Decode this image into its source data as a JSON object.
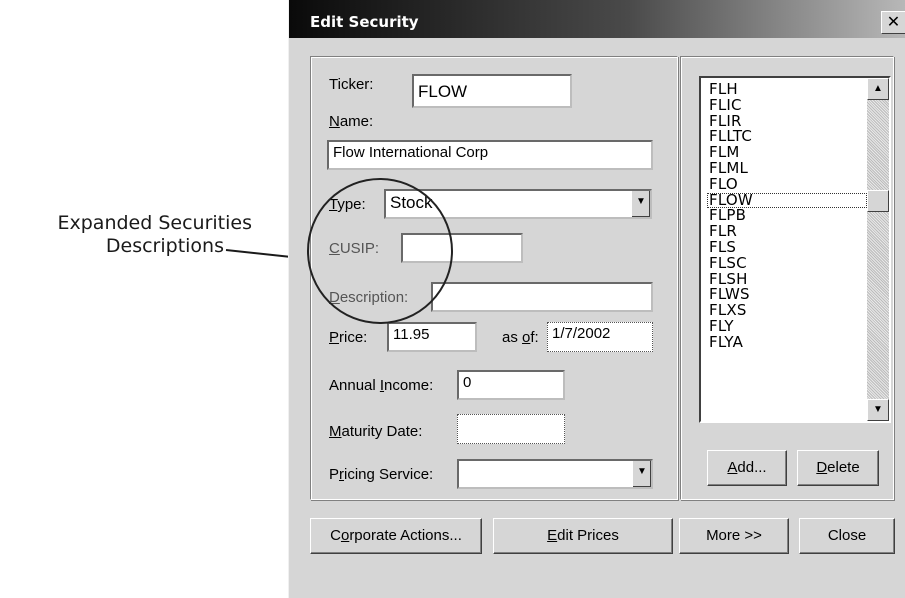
{
  "callout": {
    "line1": "Expanded Securities",
    "line2": "Descriptions"
  },
  "dialog": {
    "title": "Edit Security",
    "close_glyph": "✕",
    "ticker": {
      "label": "Ticker:",
      "value": "FLOW"
    },
    "name": {
      "label_pre": "",
      "label_u": "N",
      "label_post": "ame:",
      "value": "Flow International Corp"
    },
    "type": {
      "label_u": "T",
      "label_post": "ype:",
      "value": "Stock"
    },
    "cusip": {
      "label_u": "C",
      "label_post": "USIP:",
      "value": ""
    },
    "description": {
      "label_u": "D",
      "label_post": "escription:",
      "value": ""
    },
    "price": {
      "label_u": "P",
      "label_post": "rice:",
      "value": "11.95",
      "asof_pre": "as ",
      "asof_u": "o",
      "asof_post": "f:",
      "asof_value": "1/7/2002"
    },
    "annual_income": {
      "label_pre": "Annual ",
      "label_u": "I",
      "label_post": "ncome:",
      "value": "0"
    },
    "maturity_date": {
      "label_u": "M",
      "label_post": "aturity Date:",
      "value": ""
    },
    "pricing_service": {
      "label_pre": "P",
      "label_u": "r",
      "label_post": "icing Service:",
      "value": ""
    },
    "securities_list": [
      "FLH",
      "FLIC",
      "FLIR",
      "FLLTC",
      "FLM",
      "FLML",
      "FLO",
      "FLOW",
      "FLPB",
      "FLR",
      "FLS",
      "FLSC",
      "FLSH",
      "FLWS",
      "FLXS",
      "FLY",
      "FLYA"
    ],
    "selected_security": "FLOW",
    "buttons": {
      "add_u": "A",
      "add_post": "dd...",
      "delete_u": "D",
      "delete_post": "elete",
      "corporate_pre": "C",
      "corporate_u": "o",
      "corporate_post": "rporate Actions...",
      "edit_u": "E",
      "edit_post": "dit Prices",
      "more": "More >>",
      "close": "Close"
    }
  }
}
